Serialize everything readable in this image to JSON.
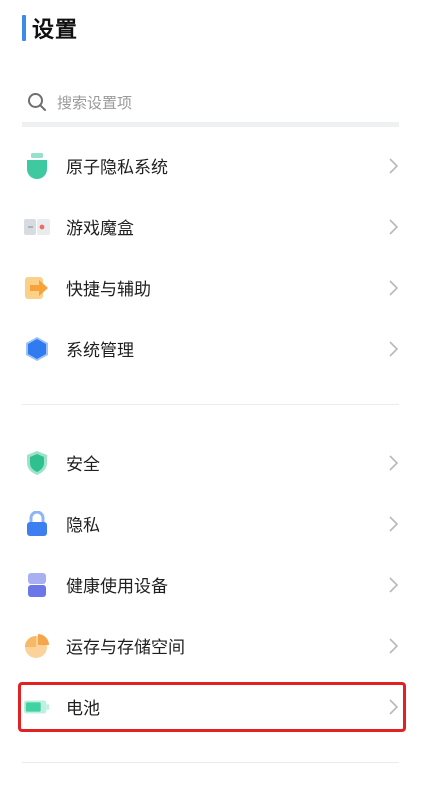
{
  "header": {
    "title": "设置"
  },
  "search": {
    "placeholder": "搜索设置项"
  },
  "group1": [
    {
      "label": "原子隐私系统",
      "icon": "privacy-system-icon"
    },
    {
      "label": "游戏魔盒",
      "icon": "game-box-icon"
    },
    {
      "label": "快捷与辅助",
      "icon": "shortcut-arrow-icon"
    },
    {
      "label": "系统管理",
      "icon": "system-hexagon-icon"
    }
  ],
  "group2": [
    {
      "label": "安全",
      "icon": "shield-icon"
    },
    {
      "label": "隐私",
      "icon": "lock-icon"
    },
    {
      "label": "健康使用设备",
      "icon": "hourglass-icon"
    },
    {
      "label": "运存与存储空间",
      "icon": "storage-pie-icon"
    },
    {
      "label": "电池",
      "icon": "battery-icon"
    }
  ],
  "colors": {
    "accent": "#3d8be8",
    "highlight_border": "#e22222",
    "privacy_green": "#3ec9a0",
    "shortcut_orange": "#f7a23b",
    "system_blue": "#2f7bef",
    "lock_blue": "#3d7ff0",
    "health_indigo": "#6b76e8",
    "storage_orange": "#f7a54a",
    "battery_green": "#3fd3a3"
  }
}
